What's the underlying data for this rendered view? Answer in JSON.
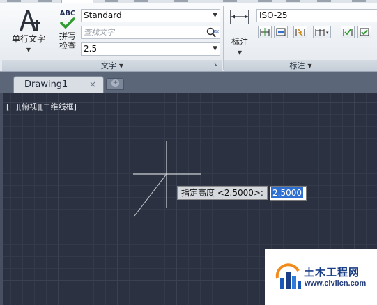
{
  "ribbon": {
    "text_panel": {
      "multiline_text": {
        "label": "单行文字"
      },
      "spellcheck": {
        "abc": "ABC",
        "label_line1": "拼写",
        "label_line2": "检查"
      },
      "text_style": {
        "value": "Standard"
      },
      "find_text": {
        "placeholder": "查找文字"
      },
      "text_height": {
        "value": "2.5"
      },
      "footer": "文字"
    },
    "dimension_panel": {
      "dimension": {
        "label": "标注"
      },
      "dim_style": {
        "value": "ISO-25"
      },
      "footer": "标注"
    }
  },
  "tabs": {
    "drawing": "Drawing1",
    "close_glyph": "×",
    "new_tab_glyph": "+"
  },
  "viewport": {
    "controls": "[−][俯视][二维线框]"
  },
  "command": {
    "prompt": "指定高度 <2.5000>:",
    "input_value": "2.5000"
  },
  "watermark": {
    "title": "土木工程网",
    "url": "www.civilcn.com"
  },
  "colors": {
    "canvas_bg": "#2b3140",
    "accent_selection": "#2f6fd2",
    "watermark_text": "#1a3f86"
  }
}
